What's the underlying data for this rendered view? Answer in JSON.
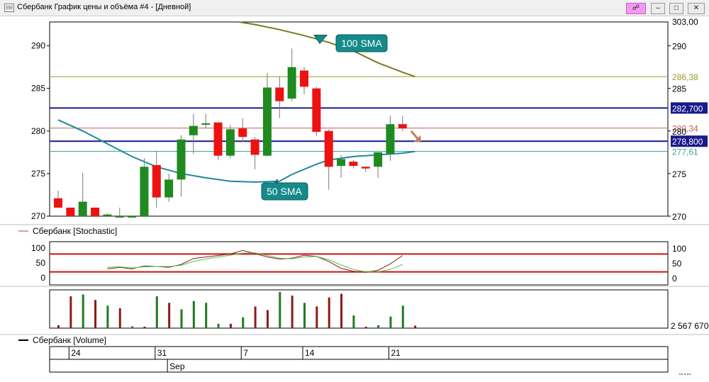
{
  "window": {
    "title": "Сбербанк График цены и объёма #4 - [Дневной]"
  },
  "panels": {
    "stochastic_label": "Сбербанк [Stochastic]",
    "volume_label": "Сбербанк [Volume]"
  },
  "chart_data": [
    {
      "type": "candlestick",
      "y_ticks": [
        270,
        275,
        280,
        285,
        290
      ],
      "ylim": [
        270,
        292.8
      ],
      "right_axis_top_label": "303,00",
      "x_ticks": [
        {
          "label": "24",
          "index": 1
        },
        {
          "label": "31",
          "index": 8
        },
        {
          "label": "7",
          "index": 15
        },
        {
          "label": "14",
          "index": 20
        },
        {
          "label": "21",
          "index": 27
        }
      ],
      "month_label": {
        "label": "Sep",
        "index": 9
      },
      "candles": [
        {
          "o": 272.1,
          "h": 273.0,
          "l": 271.0,
          "c": 271.0
        },
        {
          "o": 271.0,
          "h": 271.0,
          "l": 270.0,
          "c": 270.0
        },
        {
          "o": 270.0,
          "h": 275.1,
          "l": 270.0,
          "c": 271.7
        },
        {
          "o": 271.0,
          "h": 271.0,
          "l": 270.0,
          "c": 270.0
        },
        {
          "o": 270.0,
          "h": 270.3,
          "l": 270.0,
          "c": 270.2
        },
        {
          "o": 270.0,
          "h": 271.0,
          "l": 270.0,
          "c": 270.0
        },
        {
          "o": 270.0,
          "h": 270.0,
          "l": 270.0,
          "c": 270.0
        },
        {
          "o": 270.0,
          "h": 276.8,
          "l": 270.0,
          "c": 275.8
        },
        {
          "o": 276.0,
          "h": 277.6,
          "l": 271.0,
          "c": 272.2
        },
        {
          "o": 272.2,
          "h": 275.0,
          "l": 271.7,
          "c": 274.3
        },
        {
          "o": 274.3,
          "h": 279.5,
          "l": 272.3,
          "c": 279.0
        },
        {
          "o": 279.5,
          "h": 282.0,
          "l": 277.3,
          "c": 280.6
        },
        {
          "o": 280.8,
          "h": 282.0,
          "l": 280.3,
          "c": 280.9
        },
        {
          "o": 281.0,
          "h": 281.0,
          "l": 276.6,
          "c": 277.1
        },
        {
          "o": 277.1,
          "h": 280.7,
          "l": 276.8,
          "c": 280.2
        },
        {
          "o": 280.3,
          "h": 281.5,
          "l": 278.7,
          "c": 279.3
        },
        {
          "o": 279.0,
          "h": 279.3,
          "l": 275.5,
          "c": 277.2
        },
        {
          "o": 277.1,
          "h": 286.8,
          "l": 277.0,
          "c": 285.1
        },
        {
          "o": 285.1,
          "h": 286.4,
          "l": 281.5,
          "c": 283.5
        },
        {
          "o": 283.8,
          "h": 289.7,
          "l": 283.5,
          "c": 287.5
        },
        {
          "o": 287.1,
          "h": 287.5,
          "l": 284.3,
          "c": 285.2
        },
        {
          "o": 285.0,
          "h": 285.2,
          "l": 279.4,
          "c": 279.9
        },
        {
          "o": 280.0,
          "h": 280.2,
          "l": 273.1,
          "c": 275.8
        },
        {
          "o": 275.9,
          "h": 277.2,
          "l": 274.5,
          "c": 276.7
        },
        {
          "o": 276.4,
          "h": 276.6,
          "l": 275.6,
          "c": 275.9
        },
        {
          "o": 275.8,
          "h": 275.8,
          "l": 275.2,
          "c": 275.6
        },
        {
          "o": 275.8,
          "h": 277.0,
          "l": 274.5,
          "c": 277.5
        },
        {
          "o": 277.3,
          "h": 281.8,
          "l": 276.5,
          "c": 280.8
        },
        {
          "o": 280.8,
          "h": 281.8,
          "l": 280.0,
          "c": 280.3
        }
      ],
      "sma50": {
        "label": "50 SMA",
        "color": "#1e8a9a",
        "points": [
          [
            0,
            281.3
          ],
          [
            2,
            280.0
          ],
          [
            4,
            278.5
          ],
          [
            6,
            277.0
          ],
          [
            8,
            275.8
          ],
          [
            10,
            275.0
          ],
          [
            12,
            274.5
          ],
          [
            14,
            274.1
          ],
          [
            16,
            274.0
          ],
          [
            18,
            274.1
          ],
          [
            19,
            274.9
          ],
          [
            21,
            276.1
          ],
          [
            22,
            276.6
          ],
          [
            24,
            277.0
          ],
          [
            26,
            277.2
          ],
          [
            28,
            277.4
          ],
          [
            29,
            277.6
          ]
        ]
      },
      "sma100": {
        "label": "100 SMA",
        "color": "#7b7a1f",
        "points": [
          [
            14.7,
            292.8
          ],
          [
            16,
            292.5
          ],
          [
            18,
            291.9
          ],
          [
            20,
            291.2
          ],
          [
            22,
            290.4
          ],
          [
            24,
            289.4
          ],
          [
            26,
            288.0
          ],
          [
            28,
            286.9
          ],
          [
            29,
            286.4
          ]
        ]
      },
      "horizontal_lines": [
        {
          "value": 286.38,
          "label": "286,38",
          "color": "#9a9a2a",
          "stroke": 1,
          "label_style": "plain"
        },
        {
          "value": 282.7,
          "label": "282,700",
          "color": "#1a1a8c",
          "stroke": 2,
          "label_style": "box"
        },
        {
          "value": 280.34,
          "label": "280,34",
          "color": "#c06060",
          "stroke": 1,
          "label_style": "plain"
        },
        {
          "value": 278.8,
          "label": "278,800",
          "color": "#1a1a8c",
          "stroke": 2,
          "label_style": "box"
        },
        {
          "value": 277.61,
          "label": "277,61",
          "color": "#3aa0a0",
          "stroke": 1,
          "label_style": "plain"
        }
      ]
    },
    {
      "type": "line",
      "name": "Stochastic",
      "y_ticks": [
        0,
        50,
        100
      ],
      "ylim": [
        0,
        100
      ],
      "levels": [
        80,
        20
      ],
      "level_color": "#d01010",
      "series": [
        {
          "color": "#8b1a1a",
          "values": [
            null,
            null,
            null,
            null,
            30,
            35,
            30,
            40,
            38,
            35,
            45,
            65,
            70,
            75,
            80,
            92,
            82,
            70,
            63,
            66,
            76,
            72,
            55,
            32,
            22,
            18,
            25,
            47,
            75
          ]
        },
        {
          "color": "#4cc44c",
          "values": [
            null,
            null,
            null,
            null,
            35,
            37,
            33,
            37,
            38,
            38,
            42,
            55,
            63,
            70,
            76,
            83,
            84,
            75,
            66,
            64,
            70,
            72,
            61,
            43,
            28,
            20,
            20,
            28,
            45
          ]
        }
      ]
    },
    {
      "type": "bar",
      "name": "Volume",
      "right_label": "2 567 670",
      "ylim": [
        0,
        1
      ],
      "bars": [
        {
          "v": 0.08,
          "color": "#8b1a1a"
        },
        {
          "v": 0.88,
          "color": "#8b1a1a"
        },
        {
          "v": 0.93,
          "color": "#1f7a1f"
        },
        {
          "v": 0.78,
          "color": "#8b1a1a"
        },
        {
          "v": 0.62,
          "color": "#1f7a1f"
        },
        {
          "v": 0.55,
          "color": "#8b1a1a"
        },
        {
          "v": 0.05,
          "color": "#1f7a1f"
        },
        {
          "v": 0.04,
          "color": "#8b1a1a"
        },
        {
          "v": 0.88,
          "color": "#1f7a1f"
        },
        {
          "v": 0.7,
          "color": "#8b1a1a"
        },
        {
          "v": 0.52,
          "color": "#1f7a1f"
        },
        {
          "v": 0.75,
          "color": "#1f7a1f"
        },
        {
          "v": 0.7,
          "color": "#1f7a1f"
        },
        {
          "v": 0.12,
          "color": "#1f7a1f"
        },
        {
          "v": 0.12,
          "color": "#8b1a1a"
        },
        {
          "v": 0.3,
          "color": "#1f7a1f"
        },
        {
          "v": 0.6,
          "color": "#8b1a1a"
        },
        {
          "v": 0.5,
          "color": "#8b1a1a"
        },
        {
          "v": 1.0,
          "color": "#1f7a1f"
        },
        {
          "v": 0.9,
          "color": "#8b1a1a"
        },
        {
          "v": 0.7,
          "color": "#1f7a1f"
        },
        {
          "v": 0.6,
          "color": "#8b1a1a"
        },
        {
          "v": 0.85,
          "color": "#8b1a1a"
        },
        {
          "v": 0.95,
          "color": "#8b1a1a"
        },
        {
          "v": 0.35,
          "color": "#1f7a1f"
        },
        {
          "v": 0.04,
          "color": "#8b1a1a"
        },
        {
          "v": 0.08,
          "color": "#1f7a1f"
        },
        {
          "v": 0.32,
          "color": "#1f7a1f"
        },
        {
          "v": 0.62,
          "color": "#1f7a1f"
        },
        {
          "v": 0.07,
          "color": "#8b1a1a"
        }
      ]
    }
  ],
  "colors": {
    "up": "#1f8a1f",
    "down": "#ee1111",
    "wick": "#7a7a7a",
    "callout_bg": "#158a8a",
    "arrow": "#c08060"
  }
}
